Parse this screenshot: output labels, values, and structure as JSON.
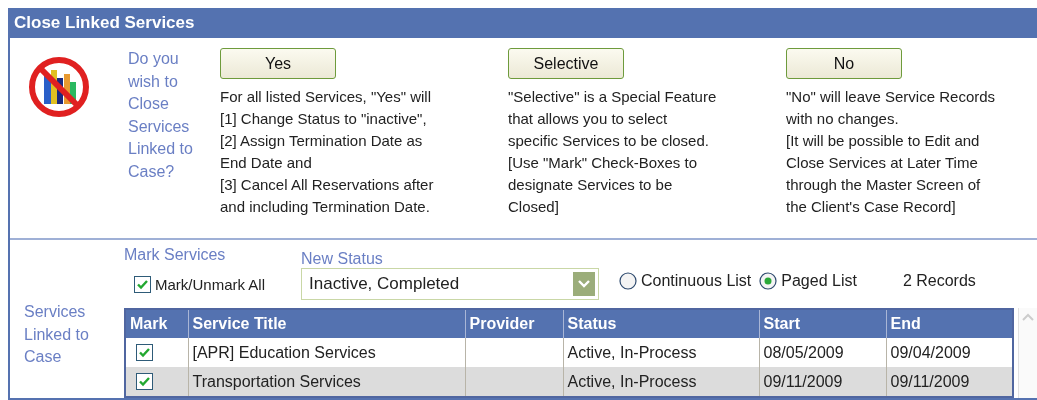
{
  "window": {
    "title": "Close Linked Services"
  },
  "prompt": "Do you\nwish to\nClose\nServices\nLinked to\nCase?",
  "choices": [
    {
      "label": "Yes",
      "description": "For all listed Services, \"Yes\" will\n[1] Change Status to \"inactive\",\n[2] Assign Termination Date as\nEnd Date and\n[3] Cancel All Reservations after\nand including Termination Date."
    },
    {
      "label": "Selective",
      "description": "\"Selective\" is a Special Feature\nthat allows you to select\nspecific Services to be closed.\n[Use \"Mark\" Check-Boxes to\ndesignate Services to be\nClosed]"
    },
    {
      "label": "No",
      "description": "\"No\" will leave Service Records\nwith no changes.\n[It will be possible to Edit and\nClose Services at Later Time\nthrough the Master Screen of\nthe Client's Case Record]"
    }
  ],
  "section_label": "Services\nLinked to\nCase",
  "mark_services": {
    "label": "Mark Services",
    "mark_all": {
      "label": "Mark/Unmark All",
      "checked": true
    }
  },
  "new_status": {
    "label": "New Status",
    "value": "Inactive, Completed"
  },
  "list_modes": [
    {
      "label": "Continuous List",
      "selected": false
    },
    {
      "label": "Paged List",
      "selected": true
    }
  ],
  "records_found": "2 Records",
  "table": {
    "columns": [
      "Mark",
      "Service Title",
      "Provider",
      "Status",
      "Start",
      "End"
    ],
    "rows": [
      {
        "marked": true,
        "service_title": "[APR] Education Services",
        "status": "Active, In-Process",
        "start": "08/05/2009",
        "end": "09/04/2009"
      },
      {
        "marked": true,
        "service_title": "Transportation Services",
        "status": "Active, In-Process",
        "start": "09/11/2009",
        "end": "09/11/2009"
      }
    ]
  }
}
